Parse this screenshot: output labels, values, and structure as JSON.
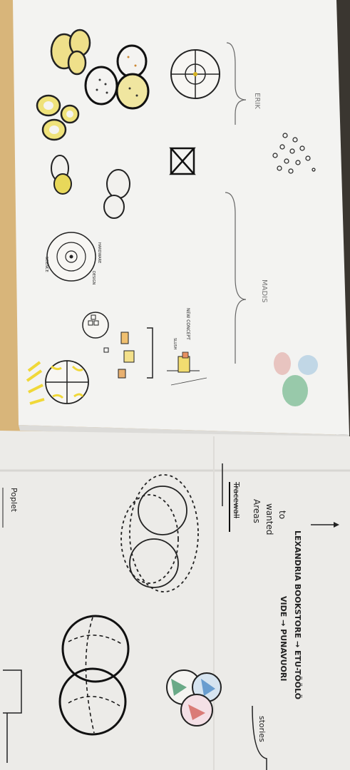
{
  "photo": {
    "upper_sheet": {
      "labels": {
        "erik": "ERIK",
        "madis": "MADIS",
        "new_concept": "NEW CONCEPT",
        "science": "SCIENCE",
        "hardware": "HARDWARE",
        "design": "DESIGN",
        "slush": "SLUSH"
      }
    },
    "lower_sheet": {
      "labels": {
        "poplet": "Poplet",
        "stories": "stories",
        "route_1": "VIDE → PUNAVUORI",
        "route_2": "LEXANDRIA BOOKSTORE → ETU-TÖÖLÖ",
        "note_crossed": "Tracewall",
        "note_1": "Areas",
        "note_2": "wanted",
        "note_3": "to"
      }
    },
    "colors": {
      "table": "#d8b57a",
      "paper": "#f2f1ef",
      "paper_shadow": "#e4e3e1",
      "ink": "#1c1c1c",
      "highlighter_yellow": "#f0e14a",
      "red_ink": "#c8372d",
      "green_ink": "#2f8a5a",
      "blue_ink": "#3a7fc0"
    }
  }
}
